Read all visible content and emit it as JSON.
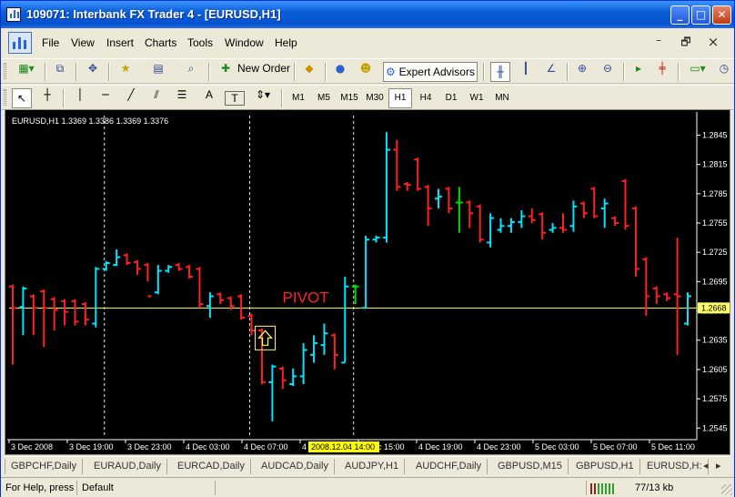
{
  "window": {
    "title": "109071: Interbank FX Trader 4 - [EURUSD,H1]",
    "minimize_glyph": "_",
    "maximize_glyph": "□",
    "close_glyph": "✕"
  },
  "menu": {
    "items": [
      "File",
      "View",
      "Insert",
      "Charts",
      "Tools",
      "Window",
      "Help"
    ],
    "mdi_minimize_glyph": "–",
    "mdi_restore_glyph": "🗗",
    "mdi_close_glyph": "×"
  },
  "toolbar": {
    "new_order_label": "New Order",
    "expert_advisors_label": "Expert Advisors",
    "icons": [
      "new-chart-icon",
      "profiles-icon",
      "crosshair-cursor-icon",
      "favorites-icon",
      "market-watch-icon",
      "history-icon",
      "new-order-icon",
      "alert-icon",
      "metaquotes-icon",
      "experts-icon",
      "expert-advisors-icon",
      "bar-chart-icon",
      "candlestick-icon",
      "line-chart-icon",
      "zoom-in-icon",
      "zoom-out-icon",
      "chart-shift-icon",
      "autoscroll-icon",
      "indicators-icon",
      "periods-icon"
    ]
  },
  "drawing_toolbar": {
    "text_tool_label": "A",
    "label_tool_label": "T",
    "icons": [
      "cursor-icon",
      "crosshair-icon",
      "vertical-line-icon",
      "horizontal-line-icon",
      "trendline-icon",
      "equidistant-channel-icon",
      "fibonacci-icon",
      "text-icon",
      "text-label-icon",
      "arrows-icon"
    ],
    "timeframes": [
      "M1",
      "M5",
      "M15",
      "M30",
      "H1",
      "H4",
      "D1",
      "W1",
      "MN"
    ],
    "active_timeframe": "H1"
  },
  "chart": {
    "header_label": "EURUSD,H1  1.3369 1.3386 1.3369 1.3376",
    "pivot_label": "PIVOT",
    "pivot_price_label": "1.2668",
    "colors": {
      "background": "#000000",
      "bull": "#00e5ff",
      "bear": "#ff2020",
      "doji": "#00dd00",
      "pivot": "#ffff66",
      "grid": "#e8e8e8",
      "axis_text": "#ffffff"
    }
  },
  "chart_data": {
    "type": "bar",
    "symbol": "EURUSD",
    "timeframe": "H1",
    "y_ticks": [
      1.2845,
      1.2815,
      1.2785,
      1.2755,
      1.2725,
      1.2695,
      1.2665,
      1.2635,
      1.2605,
      1.2575,
      1.2545
    ],
    "ylim": [
      1.2535,
      1.2865
    ],
    "x_tick_labels": [
      "3 Dec 2008",
      "3 Dec 19:00",
      "3 Dec 23:00",
      "4 Dec 03:00",
      "4 Dec 07:00",
      "4 Dec",
      "4 Dec 15:00",
      "4 Dec 19:00",
      "4 Dec 23:00",
      "5 Dec 03:00",
      "5 Dec 07:00",
      "5 Dec 11:00"
    ],
    "highlighted_time": "2008.12.04 14:00",
    "pivot": 1.2668,
    "vertical_separators_at_bar": [
      9,
      23,
      33
    ],
    "pivot_arrow_bar": 23,
    "bars": [
      {
        "o": 1.269,
        "h": 1.2692,
        "l": 1.261,
        "c": 1.2668
      },
      {
        "o": 1.2669,
        "h": 1.269,
        "l": 1.264,
        "c": 1.2688
      },
      {
        "o": 1.268,
        "h": 1.2682,
        "l": 1.264,
        "c": 1.2668
      },
      {
        "o": 1.2685,
        "h": 1.2687,
        "l": 1.2628,
        "c": 1.2668
      },
      {
        "o": 1.2677,
        "h": 1.2679,
        "l": 1.2645,
        "c": 1.2666
      },
      {
        "o": 1.2675,
        "h": 1.2677,
        "l": 1.265,
        "c": 1.2664
      },
      {
        "o": 1.2675,
        "h": 1.2677,
        "l": 1.265,
        "c": 1.2654
      },
      {
        "o": 1.2672,
        "h": 1.2674,
        "l": 1.265,
        "c": 1.2656
      },
      {
        "o": 1.2652,
        "h": 1.271,
        "l": 1.2648,
        "c": 1.2708
      },
      {
        "o": 1.2708,
        "h": 1.2716,
        "l": 1.2706,
        "c": 1.2714
      },
      {
        "o": 1.2712,
        "h": 1.2728,
        "l": 1.2711,
        "c": 1.272
      },
      {
        "o": 1.2722,
        "h": 1.2724,
        "l": 1.2712,
        "c": 1.2714
      },
      {
        "o": 1.2715,
        "h": 1.2717,
        "l": 1.2702,
        "c": 1.2708
      },
      {
        "o": 1.2712,
        "h": 1.2714,
        "l": 1.2695,
        "c": 1.268
      },
      {
        "o": 1.2684,
        "h": 1.2712,
        "l": 1.2682,
        "c": 1.2706
      },
      {
        "o": 1.2706,
        "h": 1.2712,
        "l": 1.2704,
        "c": 1.271
      },
      {
        "o": 1.2712,
        "h": 1.2714,
        "l": 1.2706,
        "c": 1.2708
      },
      {
        "o": 1.271,
        "h": 1.2712,
        "l": 1.2698,
        "c": 1.27
      },
      {
        "o": 1.2708,
        "h": 1.271,
        "l": 1.2668,
        "c": 1.2672
      },
      {
        "o": 1.267,
        "h": 1.2684,
        "l": 1.2658,
        "c": 1.268
      },
      {
        "o": 1.2682,
        "h": 1.2684,
        "l": 1.2672,
        "c": 1.2676
      },
      {
        "o": 1.2678,
        "h": 1.268,
        "l": 1.2666,
        "c": 1.267
      },
      {
        "o": 1.268,
        "h": 1.2682,
        "l": 1.2656,
        "c": 1.2658
      },
      {
        "o": 1.266,
        "h": 1.2662,
        "l": 1.264,
        "c": 1.2645
      },
      {
        "o": 1.2645,
        "h": 1.2647,
        "l": 1.259,
        "c": 1.2592
      },
      {
        "o": 1.2592,
        "h": 1.261,
        "l": 1.2552,
        "c": 1.2608
      },
      {
        "o": 1.2606,
        "h": 1.2608,
        "l": 1.2585,
        "c": 1.2594
      },
      {
        "o": 1.259,
        "h": 1.2606,
        "l": 1.2588,
        "c": 1.2598
      },
      {
        "o": 1.2598,
        "h": 1.2632,
        "l": 1.259,
        "c": 1.2625
      },
      {
        "o": 1.262,
        "h": 1.264,
        "l": 1.2612,
        "c": 1.2632
      },
      {
        "o": 1.263,
        "h": 1.2652,
        "l": 1.262,
        "c": 1.2642
      },
      {
        "o": 1.264,
        "h": 1.2642,
        "l": 1.2605,
        "c": 1.262
      },
      {
        "o": 1.2612,
        "h": 1.27,
        "l": 1.2612,
        "c": 1.269
      },
      {
        "o": 1.269,
        "h": 1.2692,
        "l": 1.2672,
        "c": 1.269
      },
      {
        "o": 1.2668,
        "h": 1.2742,
        "l": 1.2668,
        "c": 1.2738
      },
      {
        "o": 1.2738,
        "h": 1.2742,
        "l": 1.2735,
        "c": 1.274
      },
      {
        "o": 1.274,
        "h": 1.2848,
        "l": 1.2735,
        "c": 1.283
      },
      {
        "o": 1.283,
        "h": 1.284,
        "l": 1.2788,
        "c": 1.2792
      },
      {
        "o": 1.2795,
        "h": 1.2797,
        "l": 1.2788,
        "c": 1.2794
      },
      {
        "o": 1.282,
        "h": 1.2822,
        "l": 1.2788,
        "c": 1.279
      },
      {
        "o": 1.2792,
        "h": 1.2794,
        "l": 1.2752,
        "c": 1.277
      },
      {
        "o": 1.278,
        "h": 1.279,
        "l": 1.277,
        "c": 1.2782
      },
      {
        "o": 1.279,
        "h": 1.2792,
        "l": 1.2765,
        "c": 1.277
      },
      {
        "o": 1.2776,
        "h": 1.2792,
        "l": 1.2745,
        "c": 1.2776
      },
      {
        "o": 1.2776,
        "h": 1.2778,
        "l": 1.275,
        "c": 1.2765
      },
      {
        "o": 1.2772,
        "h": 1.2774,
        "l": 1.2735,
        "c": 1.2738
      },
      {
        "o": 1.2735,
        "h": 1.2765,
        "l": 1.273,
        "c": 1.276
      },
      {
        "o": 1.2748,
        "h": 1.276,
        "l": 1.2745,
        "c": 1.2752
      },
      {
        "o": 1.2752,
        "h": 1.276,
        "l": 1.2745,
        "c": 1.2756
      },
      {
        "o": 1.2756,
        "h": 1.2768,
        "l": 1.275,
        "c": 1.2762
      },
      {
        "o": 1.2762,
        "h": 1.277,
        "l": 1.2755,
        "c": 1.2758
      },
      {
        "o": 1.2764,
        "h": 1.2766,
        "l": 1.2738,
        "c": 1.2745
      },
      {
        "o": 1.2748,
        "h": 1.2755,
        "l": 1.2745,
        "c": 1.275
      },
      {
        "o": 1.275,
        "h": 1.2765,
        "l": 1.2745,
        "c": 1.2748
      },
      {
        "o": 1.2752,
        "h": 1.2778,
        "l": 1.2746,
        "c": 1.2772
      },
      {
        "o": 1.2775,
        "h": 1.2777,
        "l": 1.276,
        "c": 1.2765
      },
      {
        "o": 1.279,
        "h": 1.2792,
        "l": 1.276,
        "c": 1.2762
      },
      {
        "o": 1.277,
        "h": 1.278,
        "l": 1.275,
        "c": 1.2775
      },
      {
        "o": 1.276,
        "h": 1.2762,
        "l": 1.2752,
        "c": 1.2755
      },
      {
        "o": 1.2798,
        "h": 1.28,
        "l": 1.2748,
        "c": 1.2752
      },
      {
        "o": 1.277,
        "h": 1.2772,
        "l": 1.27,
        "c": 1.2708
      },
      {
        "o": 1.2718,
        "h": 1.272,
        "l": 1.266,
        "c": 1.268
      },
      {
        "o": 1.2688,
        "h": 1.269,
        "l": 1.2672,
        "c": 1.268
      },
      {
        "o": 1.2682,
        "h": 1.2684,
        "l": 1.2675,
        "c": 1.2678
      },
      {
        "o": 1.2682,
        "h": 1.274,
        "l": 1.262,
        "c": 1.268
      },
      {
        "o": 1.2652,
        "h": 1.2684,
        "l": 1.265,
        "c": 1.268
      }
    ]
  },
  "tabs": [
    "GBPCHF,Daily",
    "EURAUD,Daily",
    "EURCAD,Daily",
    "AUDCAD,Daily",
    "AUDJPY,H1",
    "AUDCHF,Daily",
    "GBPUSD,M15",
    "GBPUSD,H1",
    "EURUSD,H:"
  ],
  "tab_nav": {
    "left": "◂",
    "right": "▸"
  },
  "status": {
    "help_text": "For Help, press",
    "profile": "Default",
    "traffic": "77/13 kb"
  }
}
